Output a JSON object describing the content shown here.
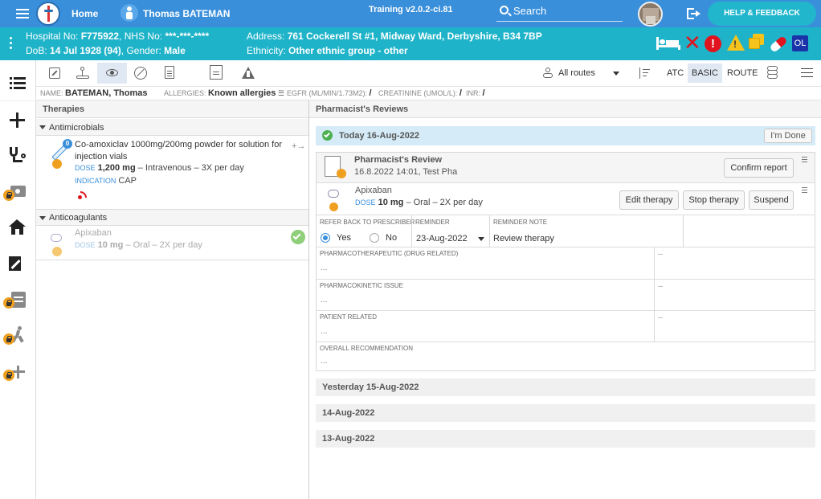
{
  "topbar": {
    "home_label": "Home",
    "patient_name": "Thomas BATEMAN",
    "version": "Training v2.0.2-ci.81",
    "search_placeholder": "Search",
    "help_label": "HELP & FEEDBACK"
  },
  "patient": {
    "hospital_no_label": "Hospital No:",
    "hospital_no": "F775922",
    "nhs_no_label": "NHS No:",
    "nhs_no": "***-***-****",
    "dob_label": "DoB:",
    "dob": "14 Jul 1928 (94)",
    "gender_label": "Gender:",
    "gender": "Male",
    "address_label": "Address:",
    "address": "761 Cockerell St #1, Midway Ward, Derbyshire, B34 7BP",
    "ethnicity_label": "Ethnicity:",
    "ethnicity": "Other ethnic group - other",
    "ol_badge": "OL"
  },
  "toolbar": {
    "routes_label": "All routes",
    "atc_label": "ATC",
    "basic_label": "BASIC",
    "route_label": "ROUTE"
  },
  "info": {
    "name_label": "NAME:",
    "name": "BATEMAN, Thomas",
    "allergies_label": "ALLERGIES:",
    "allergies": "Known allergies",
    "egfr_label": "EGFR (ML/MIN/1.73M2):",
    "egfr": "/",
    "creatinine_label": "CREATININE (UMOL/L):",
    "creatinine": "/",
    "inr_label": "INR:",
    "inr": "/"
  },
  "therapies": {
    "title": "Therapies",
    "groups": [
      {
        "name": "Antimicrobials",
        "item": {
          "badge": "0",
          "drug": "Co-amoxiclav 1000mg/200mg powder for solution for injection vials",
          "dose_label": "DOSE",
          "dose": "1,200 mg",
          "route": "– Intravenous – 3X per day",
          "indication_label": "INDICATION",
          "indication": "CAP"
        }
      },
      {
        "name": "Anticoagulants",
        "item": {
          "drug": "Apixaban",
          "dose_label": "DOSE",
          "dose": "10 mg",
          "route": "– Oral – 2X per day"
        }
      }
    ]
  },
  "reviews": {
    "title": "Pharmacist's Reviews",
    "today": "Today 16-Aug-2022",
    "done_button": "I'm Done",
    "review_title": "Pharmacist's Review",
    "review_meta": "16.8.2022 14:01, Test Pha",
    "confirm_button": "Confirm report",
    "drug": "Apixaban",
    "dose_label": "DOSE",
    "dose": "10 mg",
    "route": "– Oral – 2X per day",
    "edit_button": "Edit therapy",
    "stop_button": "Stop therapy",
    "suspend_button": "Suspend",
    "refer_label": "REFER BACK TO PRESCRIBER",
    "yes": "Yes",
    "no": "No",
    "reminder_label": "REMINDER",
    "reminder_value": "23-Aug-2022",
    "reminder_note_label": "REMINDER NOTE",
    "reminder_note": "Review therapy",
    "pharmaco_label": "PHARMACOTHERAPEUTIC (DRUG RELATED)",
    "pharmaco_value": "...",
    "pharmaco_side": "--",
    "kinetic_label": "PHARMACOKINETIC ISSUE",
    "kinetic_value": "...",
    "kinetic_side": "--",
    "patient_label": "PATIENT RELATED",
    "patient_value": "...",
    "patient_side": "--",
    "overall_label": "OVERALL RECOMMENDATION",
    "overall_value": "...",
    "yesterday": "Yesterday 15-Aug-2022",
    "day2": "14-Aug-2022",
    "day3": "13-Aug-2022"
  }
}
